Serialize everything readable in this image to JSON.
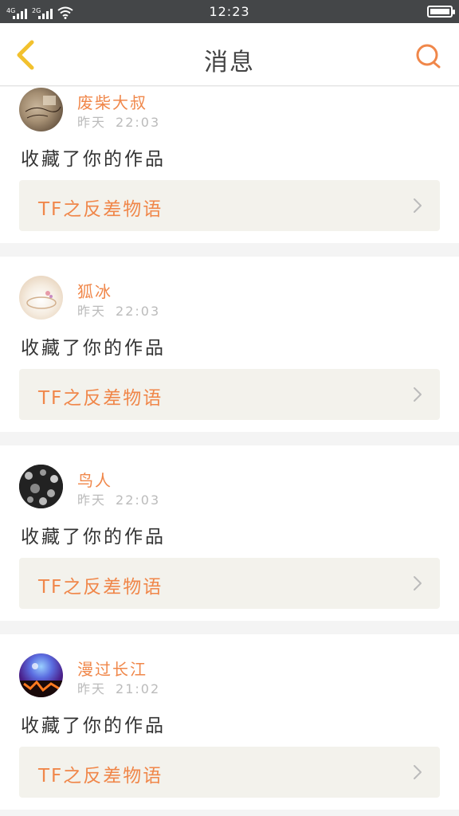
{
  "status_bar": {
    "network1": "4G",
    "network2": "2G",
    "time": "12:23"
  },
  "header": {
    "title": "消息",
    "back_icon": "chevron-left-icon",
    "search_icon": "search-icon"
  },
  "colors": {
    "accent": "#f0874a",
    "back_icon": "#f2c12e",
    "link_bg": "#f3f2ec"
  },
  "notifications": [
    {
      "username": "废柴大叔",
      "date": "昨天",
      "time": "22:03",
      "action": "收藏了你的作品",
      "work_title": "TF之反差物语"
    },
    {
      "username": "狐冰",
      "date": "昨天",
      "time": "22:03",
      "action": "收藏了你的作品",
      "work_title": "TF之反差物语"
    },
    {
      "username": "鸟人",
      "date": "昨天",
      "time": "22:03",
      "action": "收藏了你的作品",
      "work_title": "TF之反差物语"
    },
    {
      "username": "漫过长江",
      "date": "昨天",
      "time": "21:02",
      "action": "收藏了你的作品",
      "work_title": "TF之反差物语"
    }
  ]
}
